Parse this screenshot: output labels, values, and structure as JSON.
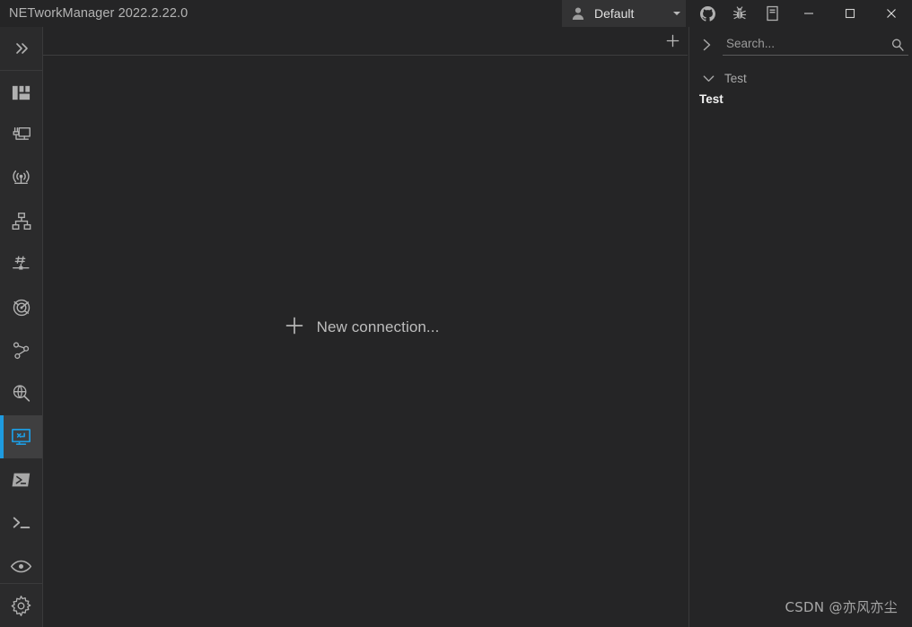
{
  "window": {
    "title": "NETworkManager 2022.2.22.0",
    "profile": {
      "icon": "person-icon",
      "label": "Default",
      "caret_icon": "chevron-down-icon"
    },
    "titlebar_actions": [
      {
        "name": "github-icon",
        "label": "GitHub"
      },
      {
        "name": "bug-icon",
        "label": "Report a bug"
      },
      {
        "name": "book-icon",
        "label": "Documentation"
      }
    ],
    "controls": [
      {
        "name": "minimize-button",
        "glyph": "minimize-icon"
      },
      {
        "name": "maximize-button",
        "glyph": "maximize-icon"
      },
      {
        "name": "close-button",
        "glyph": "close-icon"
      }
    ]
  },
  "sidebar": {
    "toggle": {
      "name": "expand-menu-icon",
      "label": "Expand"
    },
    "items": [
      {
        "name": "dashboard",
        "label": "Dashboard",
        "icon": "dashboard-icon",
        "selected": false
      },
      {
        "name": "network-interface",
        "label": "Network Interface",
        "icon": "network-interface-icon",
        "selected": false
      },
      {
        "name": "wifi",
        "label": "WiFi",
        "icon": "wifi-icon",
        "selected": false
      },
      {
        "name": "ip-scanner",
        "label": "IP Scanner",
        "icon": "network-topology-icon",
        "selected": false
      },
      {
        "name": "port-scanner",
        "label": "Port Scanner",
        "icon": "hash-port-icon",
        "selected": false
      },
      {
        "name": "ping-monitor",
        "label": "Ping Monitor",
        "icon": "radar-icon",
        "selected": false
      },
      {
        "name": "traceroute",
        "label": "Traceroute",
        "icon": "traceroute-icon",
        "selected": false
      },
      {
        "name": "dns-lookup",
        "label": "DNS Lookup",
        "icon": "globe-search-icon",
        "selected": false
      },
      {
        "name": "remote-desktop",
        "label": "Remote Desktop",
        "icon": "remote-desktop-icon",
        "selected": true
      },
      {
        "name": "powershell",
        "label": "PowerShell",
        "icon": "powershell-icon",
        "selected": false
      },
      {
        "name": "putty",
        "label": "PuTTY",
        "icon": "terminal-icon",
        "selected": false
      },
      {
        "name": "tigervnc",
        "label": "TigerVNC",
        "icon": "eye-icon",
        "selected": false
      }
    ],
    "settings": {
      "name": "settings",
      "label": "Settings",
      "icon": "gear-icon"
    }
  },
  "main": {
    "tabstrip": {
      "add_tab": {
        "name": "add-tab-icon",
        "label": "+"
      }
    },
    "empty_state": {
      "icon": "plus-icon",
      "label": "New connection..."
    }
  },
  "right_panel": {
    "expand": {
      "name": "chevron-right-icon",
      "label": ">"
    },
    "search": {
      "placeholder": "Search...",
      "value": "",
      "search_icon": "search-icon",
      "add_icon": "plus-icon"
    },
    "tree": {
      "groups": [
        {
          "name": "Test",
          "expanded": true,
          "chevron": "chevron-down-icon",
          "items": [
            {
              "name": "Test"
            }
          ]
        }
      ]
    }
  },
  "watermark": {
    "text": "CSDN @亦风亦尘"
  },
  "colors": {
    "window_bg": "#252526",
    "rail_bg": "#2b2b2c",
    "selected_bg": "#3f3f40",
    "accent": "#1e9be0",
    "icon": "#b4b4b4",
    "text": "#cfcfcf",
    "divider": "#3a3a3b"
  }
}
